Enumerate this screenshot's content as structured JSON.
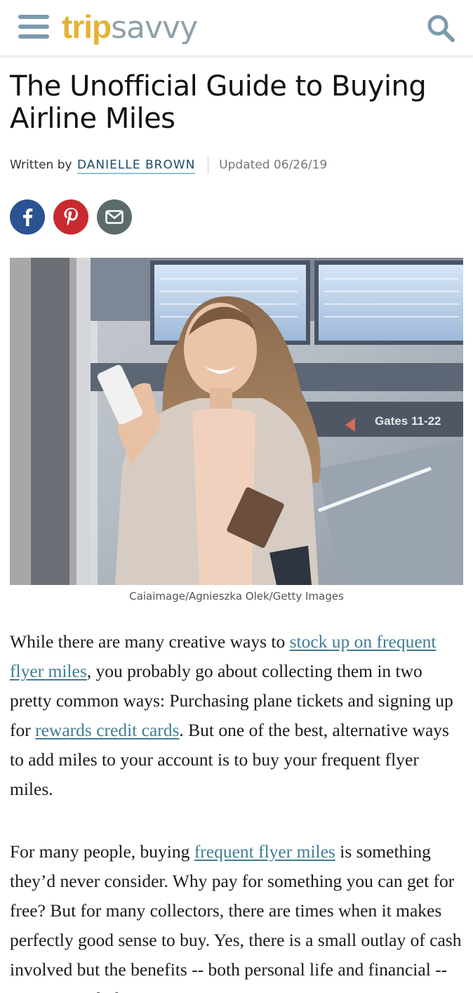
{
  "header": {
    "logo_trip": "trip",
    "logo_savvy": "savvy",
    "logo_trip_color": "#e2b336",
    "logo_savvy_color": "#8fa1ab",
    "menu_icon": "hamburger-menu-icon",
    "search_icon": "search-icon"
  },
  "article": {
    "title": "The Unofficial Guide to Buying Airline Miles",
    "written_by": "Written by",
    "author": "DANIELLE BROWN",
    "updated": "Updated 06/26/19",
    "share": {
      "facebook": "facebook-icon",
      "pinterest": "pinterest-icon",
      "email": "email-icon"
    },
    "image_sign": "Gates 11-22",
    "caption": "Caiaimage/Agnieszka Olek/Getty Images",
    "p1": {
      "t1": "While there are many creative ways to ",
      "link1": "stock up on frequent flyer miles",
      "t2": ", you probably go about collecting them in two pretty common ways: Purchasing plane tickets and signing up for ",
      "link2": "rewards credit cards",
      "t3": ". But one of the best, alternative ways to add miles to your account is to buy your frequent flyer miles."
    },
    "p2": {
      "t1": "For many people, buying ",
      "link1": "frequent flyer miles",
      "t2": " is something they’d never consider. Why pay for something you can get for free? But for many collectors, there are times when it makes perfectly good sense to buy. Yes, there is a small outlay of cash involved but the benefits -- both personal life and financial -- can outweigh the cost."
    }
  },
  "colors": {
    "link": "#3f7d93",
    "author_underline": "#8fc2d8",
    "facebook": "#2c5391",
    "pinterest": "#c82a30",
    "email": "#5b6b6c"
  }
}
